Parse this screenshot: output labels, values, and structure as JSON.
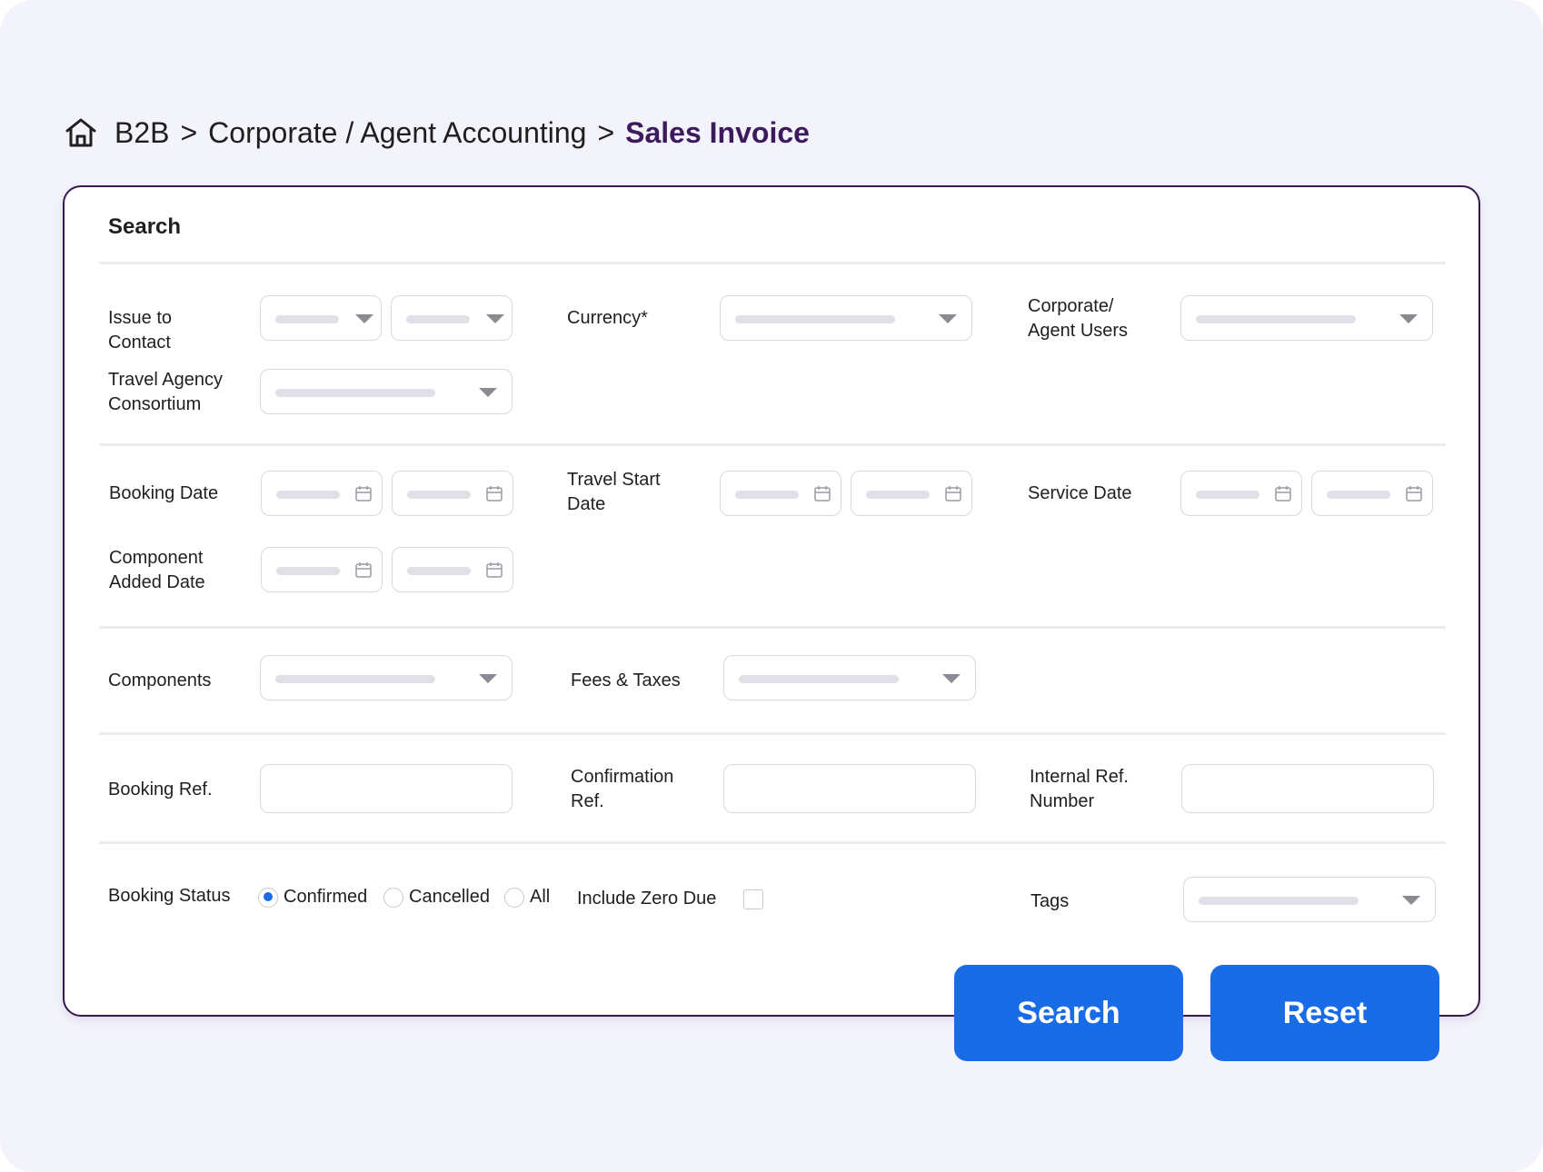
{
  "breadcrumb": {
    "items": [
      "B2B",
      "Corporate / Agent Accounting"
    ],
    "separator": ">",
    "current": "Sales Invoice"
  },
  "panel": {
    "title": "Search"
  },
  "fields": {
    "issue_to_contact": "Issue to\nContact",
    "travel_agency_consortium": "Travel Agency\nConsortium",
    "currency": "Currency*",
    "corporate_agent_users": "Corporate/\nAgent Users",
    "booking_date": "Booking Date",
    "travel_start_date": "Travel Start\nDate",
    "service_date": "Service Date",
    "component_added_date": "Component\nAdded Date",
    "components": "Components",
    "fees_taxes": "Fees & Taxes",
    "booking_ref": "Booking Ref.",
    "confirmation_ref": "Confirmation\nRef.",
    "internal_ref_number": "Internal Ref.\nNumber",
    "booking_status": "Booking Status",
    "include_zero_due": "Include Zero Due",
    "tags": "Tags"
  },
  "booking_status_options": [
    "Confirmed",
    "Cancelled",
    "All"
  ],
  "booking_status_selected": "Confirmed",
  "include_zero_due_checked": false,
  "buttons": {
    "search": "Search",
    "reset": "Reset"
  },
  "colors": {
    "accent": "#1a6ce6",
    "breadcrumb_current": "#3d1a5c",
    "panel_border": "#3a1850",
    "background": "#f3f3fc"
  }
}
